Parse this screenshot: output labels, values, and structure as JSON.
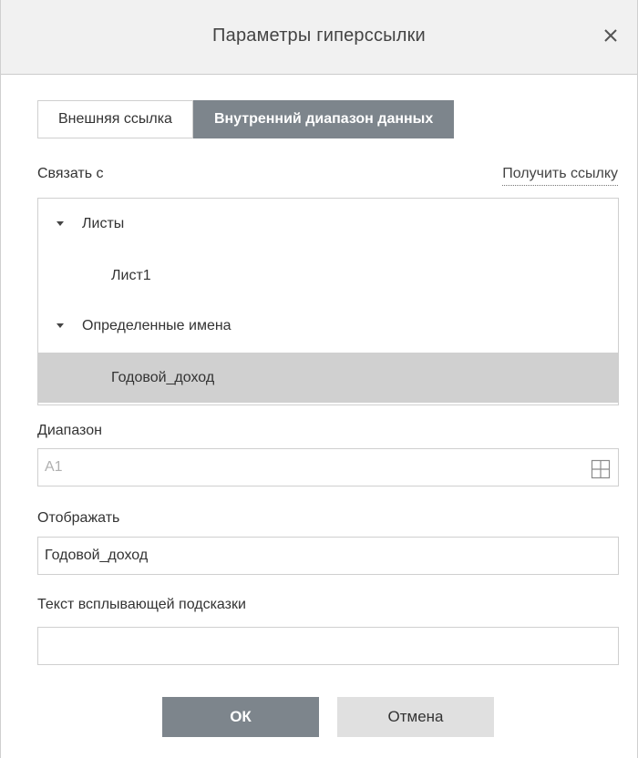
{
  "dialog": {
    "title": "Параметры гиперссылки",
    "close_icon": "close-icon"
  },
  "tabs": [
    {
      "label": "Внешняя ссылка",
      "active": false
    },
    {
      "label": "Внутренний диапазон данных",
      "active": true
    }
  ],
  "link_to": {
    "label": "Связать с",
    "get_link_label": "Получить ссылку"
  },
  "tree": {
    "items": [
      {
        "label": "Листы",
        "expanded": true,
        "level": 0
      },
      {
        "label": "Лист1",
        "level": 1
      },
      {
        "label": "Определенные имена",
        "expanded": true,
        "level": 0
      },
      {
        "label": "Годовой_доход",
        "level": 1,
        "selected": true
      }
    ]
  },
  "range": {
    "label": "Диапазон",
    "value": "A1",
    "icon": "grid-icon"
  },
  "display": {
    "label": "Отображать",
    "value": "Годовой_доход"
  },
  "tooltip": {
    "label": "Текст всплывающей подсказки",
    "value": ""
  },
  "buttons": {
    "ok": "ОК",
    "cancel": "Отмена"
  },
  "colors": {
    "accent": "#7d858c",
    "selected_row": "#d0d0d0",
    "titlebar": "#f1f1f1"
  }
}
